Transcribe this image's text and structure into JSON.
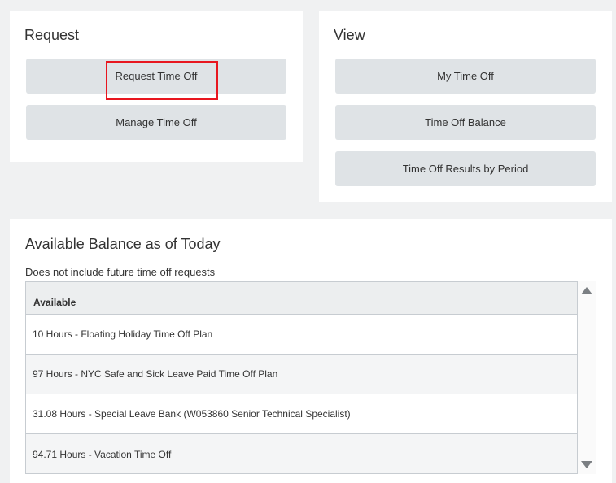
{
  "request": {
    "title": "Request",
    "buttons": [
      "Request Time Off",
      "Manage Time Off"
    ]
  },
  "view": {
    "title": "View",
    "buttons": [
      "My Time Off",
      "Time Off Balance",
      "Time Off Results by Period"
    ]
  },
  "balance": {
    "title": "Available Balance as of Today",
    "subtitle": "Does not include future time off requests",
    "column_header": "Available",
    "rows": [
      "10 Hours - Floating Holiday Time Off Plan",
      "97 Hours - NYC Safe and Sick Leave Paid Time Off Plan",
      "31.08 Hours - Special Leave Bank (W053860 Senior Technical Specialist)",
      "94.71 Hours - Vacation Time Off"
    ]
  },
  "colors": {
    "highlight": "#e8161f",
    "button_bg": "#dfe3e6"
  }
}
